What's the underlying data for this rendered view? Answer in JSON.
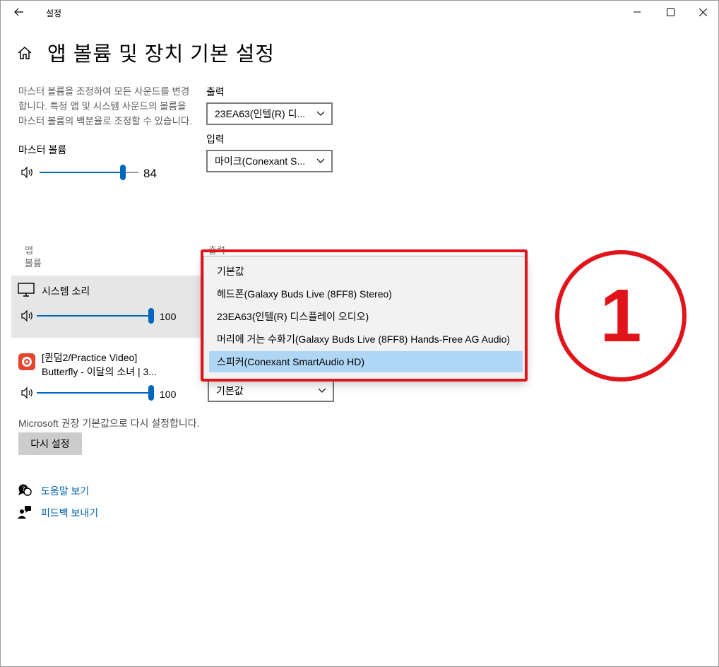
{
  "window": {
    "title": "설정"
  },
  "page": {
    "title": "앱 볼륨 및 장치 기본 설정",
    "description": "마스터 볼륨을 조정하여 모든 사운드를 변경합니다. 특정 앱 및 시스템 사운드의 볼륨을 마스터 볼륨의 백분율로 조정할 수 있습니다."
  },
  "master": {
    "label": "마스터 볼륨",
    "volume": 84,
    "volume_text": "84"
  },
  "device_defaults": {
    "output_label": "출력",
    "output_value": "23EA63(인텔(R) 디...",
    "input_label": "입력",
    "input_value": "마이크(Conexant S..."
  },
  "app_columns": {
    "app_header_line1": "앱",
    "app_header_line2": "볼륨",
    "output_header": "출력"
  },
  "apps": [
    {
      "name": "시스템 소리",
      "volume": 100,
      "volume_text": "100"
    },
    {
      "name_line1": "[퀸덤2/Practice Video]",
      "name_line2": "Butterfly - 이달의 소녀 | 3...",
      "volume": 100,
      "volume_text": "100",
      "output_value": "기본값"
    }
  ],
  "output_dropdown": {
    "options": [
      "기본값",
      "헤드폰(Galaxy Buds Live (8FF8) Stereo)",
      "23EA63(인텔(R) 디스플레이 오디오)",
      "머리에 거는 수화기(Galaxy Buds Live (8FF8) Hands-Free AG Audio)",
      "스피커(Conexant SmartAudio HD)"
    ],
    "selected_index": 4
  },
  "reset": {
    "hint": "Microsoft 권장 기본값으로 다시 설정합니다.",
    "button_label": "다시 설정"
  },
  "links": {
    "help": "도움말 보기",
    "feedback": "피드백 보내기"
  },
  "annotation": {
    "marker": "1",
    "color": "#e2141b"
  },
  "colors": {
    "accent": "#0067c0",
    "link": "#0063b1",
    "selection": "#b0d6f5"
  }
}
